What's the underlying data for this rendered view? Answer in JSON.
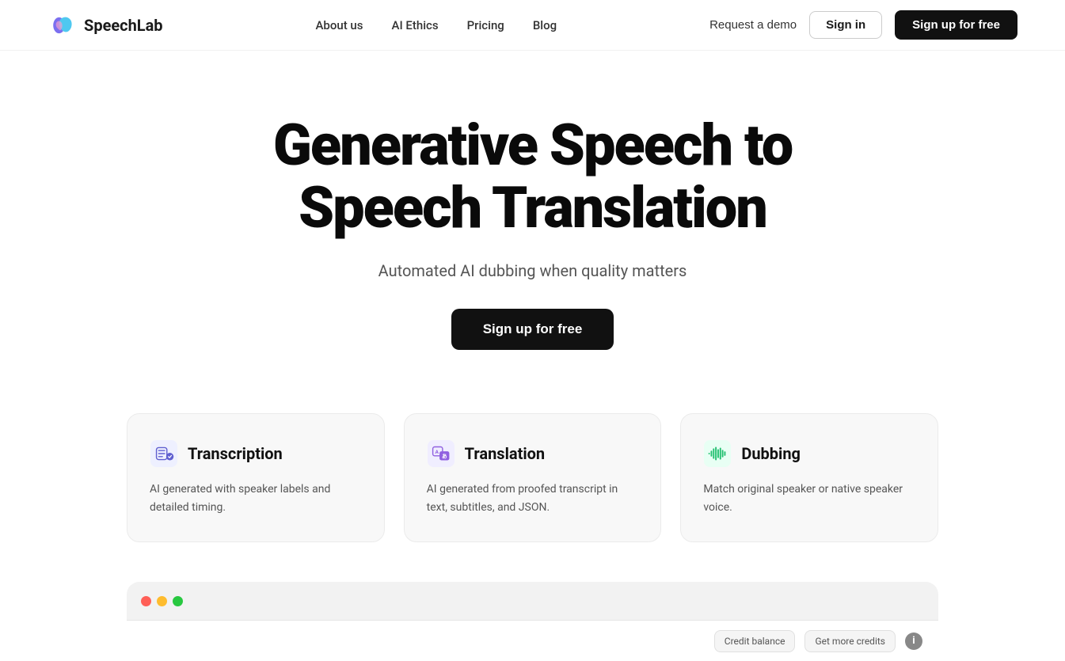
{
  "header": {
    "logo_text": "SpeechLab",
    "nav": {
      "about": "About us",
      "ai_ethics": "AI Ethics",
      "pricing": "Pricing",
      "blog": "Blog"
    },
    "actions": {
      "demo": "Request a demo",
      "signin": "Sign in",
      "signup": "Sign up for free"
    }
  },
  "hero": {
    "heading_line1": "Generative Speech to",
    "heading_line2": "Speech Translation",
    "subtitle": "Automated AI dubbing when quality matters",
    "cta": "Sign up for free"
  },
  "features": [
    {
      "id": "transcription",
      "title": "Transcription",
      "description": "AI generated with speaker labels and detailed timing.",
      "icon_label": "transcription-icon"
    },
    {
      "id": "translation",
      "title": "Translation",
      "description": "AI generated from proofed transcript in text, subtitles, and JSON.",
      "icon_label": "translation-icon"
    },
    {
      "id": "dubbing",
      "title": "Dubbing",
      "description": "Match original speaker or native speaker voice.",
      "icon_label": "dubbing-icon"
    }
  ],
  "app_preview": {
    "credit_balance_label": "Credit balance",
    "get_credits_label": "Get more credits"
  },
  "colors": {
    "brand_dark": "#111111",
    "accent_blue": "#4a6cf7",
    "dot_red": "#ff5f57",
    "dot_yellow": "#febc2e",
    "dot_green": "#28c840"
  }
}
